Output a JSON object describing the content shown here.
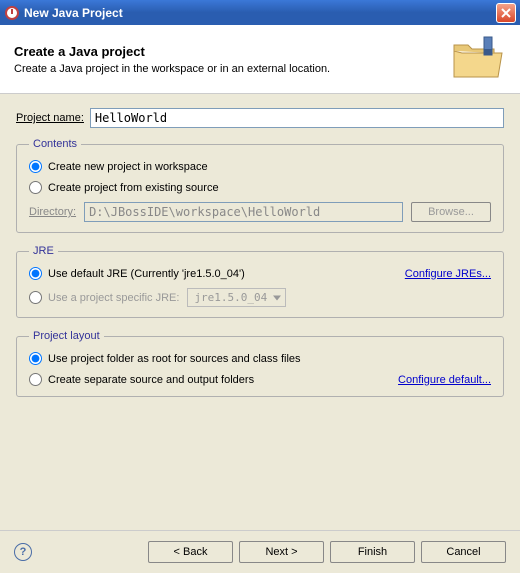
{
  "window": {
    "title": "New Java Project"
  },
  "header": {
    "title": "Create a Java project",
    "subtitle": "Create a Java project in the workspace or in an external location."
  },
  "project_name": {
    "label": "Project name:",
    "value": "HelloWorld"
  },
  "contents": {
    "legend": "Contents",
    "opt_workspace": "Create new project in workspace",
    "opt_existing": "Create project from existing source",
    "directory_label": "Directory:",
    "directory_value": "D:\\JBossIDE\\workspace\\HelloWorld",
    "browse": "Browse..."
  },
  "jre": {
    "legend": "JRE",
    "opt_default": "Use default JRE (Currently 'jre1.5.0_04')",
    "configure": "Configure JREs...",
    "opt_specific": "Use a project specific JRE:",
    "specific_value": "jre1.5.0_04"
  },
  "layout": {
    "legend": "Project layout",
    "opt_root": "Use project folder as root for sources and class files",
    "opt_separate": "Create separate source and output folders",
    "configure": "Configure default..."
  },
  "buttons": {
    "back": "< Back",
    "next": "Next >",
    "finish": "Finish",
    "cancel": "Cancel"
  }
}
